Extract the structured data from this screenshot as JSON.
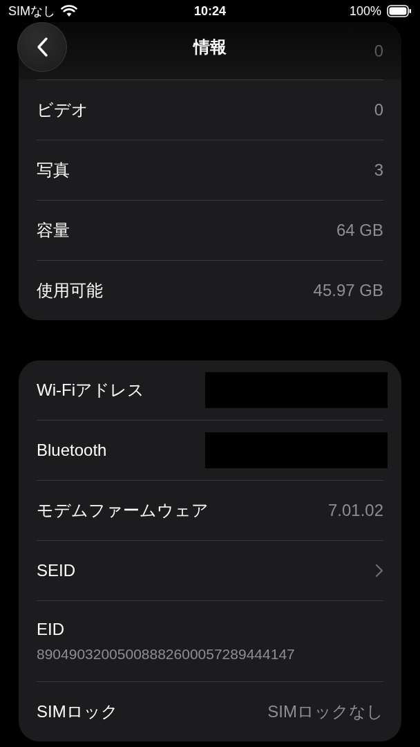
{
  "status_bar": {
    "carrier": "SIMなし",
    "time": "10:24",
    "battery": "100%"
  },
  "header": {
    "title": "情報"
  },
  "cards": [
    {
      "faded_value": "0",
      "rows": [
        {
          "kind": "value",
          "label": "ビデオ",
          "value": "0"
        },
        {
          "kind": "value",
          "label": "写真",
          "value": "3"
        },
        {
          "kind": "value",
          "label": "容量",
          "value": "64 GB"
        },
        {
          "kind": "value",
          "label": "使用可能",
          "value": "45.97 GB"
        }
      ]
    },
    {
      "rows": [
        {
          "kind": "redacted",
          "label": "Wi-Fiアドレス"
        },
        {
          "kind": "redacted",
          "label": "Bluetooth"
        },
        {
          "kind": "value",
          "label": "モデムファームウェア",
          "value": "7.01.02"
        },
        {
          "kind": "link",
          "label": "SEID"
        },
        {
          "kind": "stacked",
          "label": "EID",
          "value": "89049032005008882600057289444147"
        },
        {
          "kind": "value",
          "label": "SIMロック",
          "value": "SIMロックなし"
        }
      ]
    }
  ]
}
